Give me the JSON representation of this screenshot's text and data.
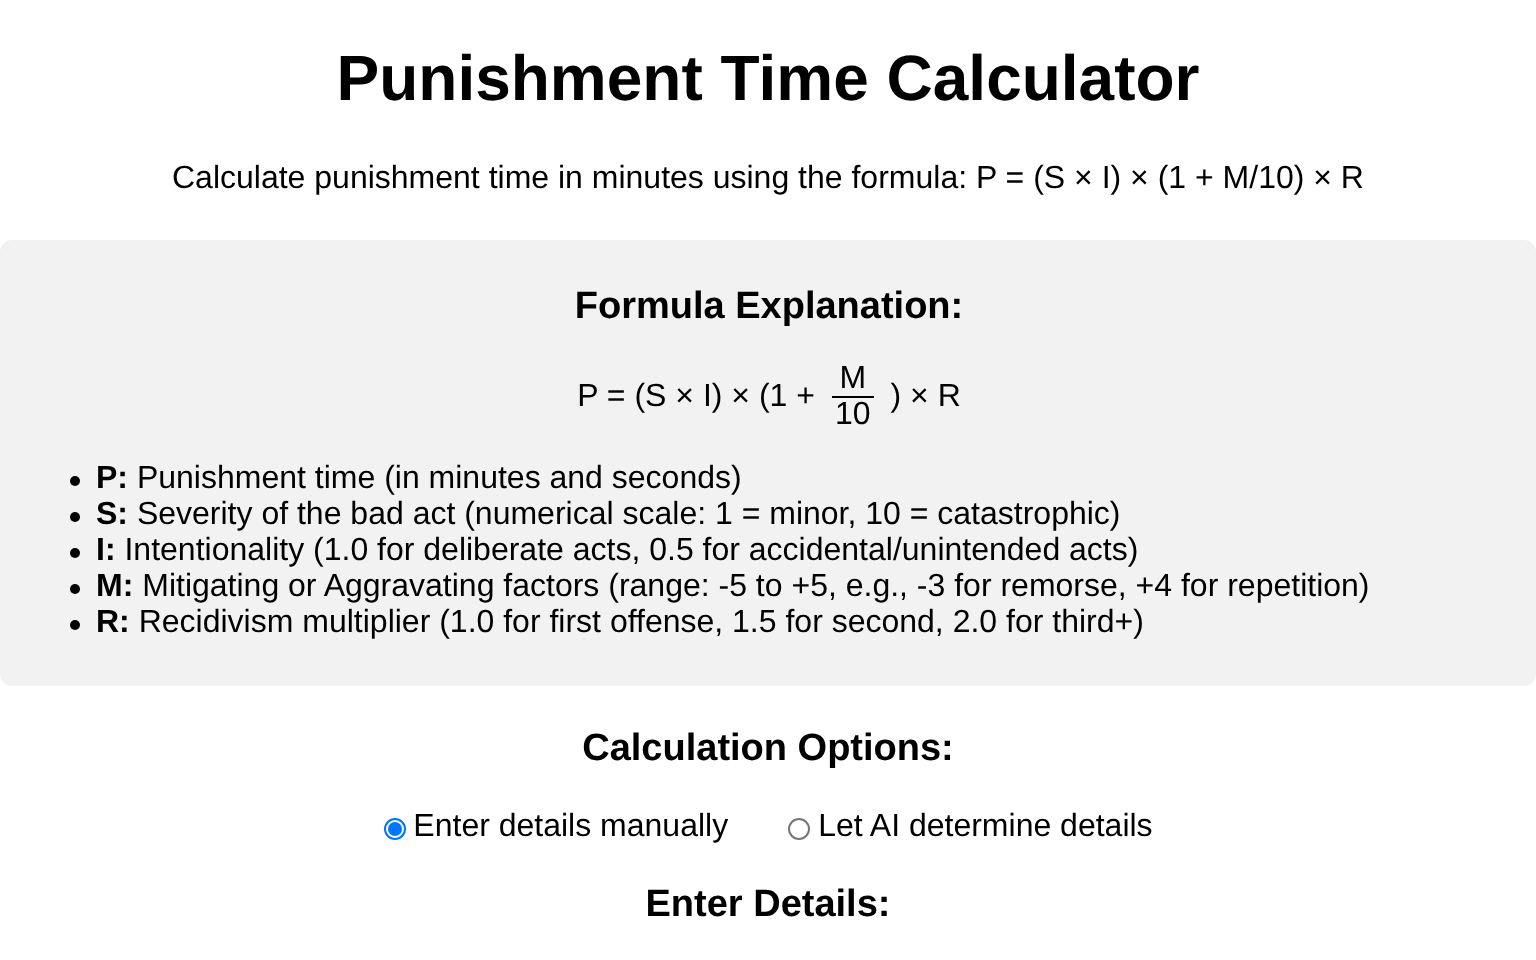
{
  "title": "Punishment Time Calculator",
  "subtitle": "Calculate punishment time in minutes using the formula: P = (S × I) × (1 + M/10) × R",
  "explanation": {
    "heading": "Formula Explanation:",
    "formula": {
      "before": "P = (S × I) × (1 +",
      "numerator": "M",
      "denominator": "10",
      "after": ") × R"
    },
    "items": [
      {
        "term": "P:",
        "text": "Punishment time (in minutes and seconds)"
      },
      {
        "term": "S:",
        "text": "Severity of the bad act (numerical scale: 1 = minor, 10 = catastrophic)"
      },
      {
        "term": "I:",
        "text": "Intentionality (1.0 for deliberate acts, 0.5 for accidental/unintended acts)"
      },
      {
        "term": "M:",
        "text": "Mitigating or Aggravating factors (range: -5 to +5, e.g., -3 for remorse, +4 for repetition)"
      },
      {
        "term": "R:",
        "text": "Recidivism multiplier (1.0 for first offense, 1.5 for second, 2.0 for third+)"
      }
    ]
  },
  "options": {
    "heading": "Calculation Options:",
    "radios": [
      {
        "label": "Enter details manually",
        "selected": true
      },
      {
        "label": "Let AI determine details",
        "selected": false
      }
    ]
  },
  "details": {
    "heading": "Enter Details:"
  }
}
